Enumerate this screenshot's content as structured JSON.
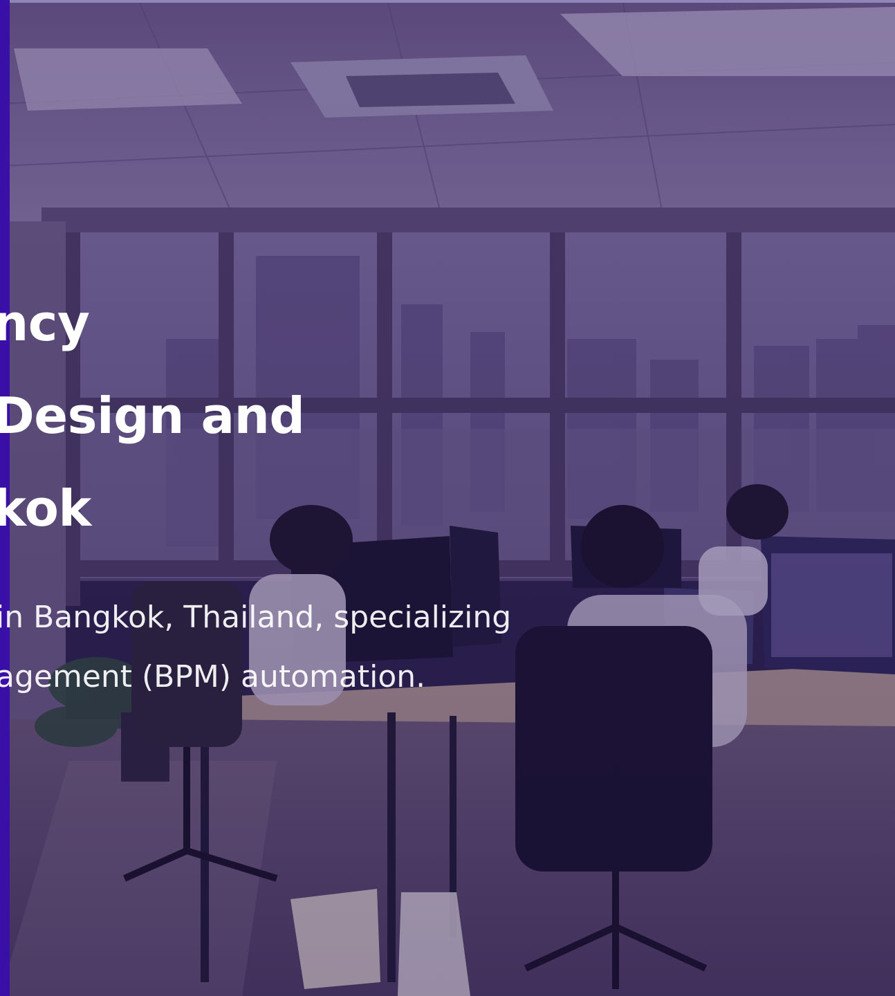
{
  "hero": {
    "headline_lines": [
      "ncy",
      "Design and",
      "kok"
    ],
    "subtext_lines": [
      " in Bangkok, Thailand, specializing",
      "agement (BPM) automation."
    ]
  },
  "colors": {
    "overlay": "#3b2a6e",
    "accent_bar": "#3a0fa8",
    "top_strip": "#8e86b8",
    "text": "#ffffff"
  },
  "icons": {
    "background": "office-photo"
  }
}
